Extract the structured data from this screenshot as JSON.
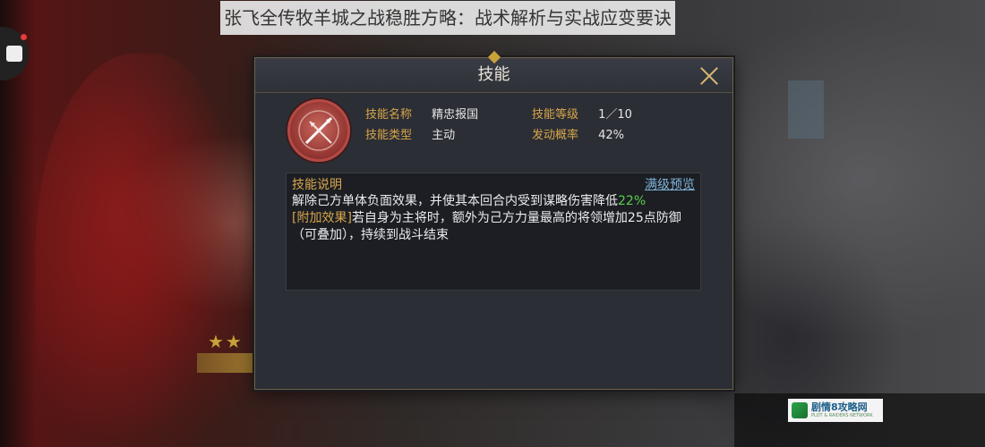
{
  "article_title": "张飞全传牧羊城之战稳胜方略：战术解析与实战应变要诀",
  "dialog": {
    "title": "技能",
    "close_icon": "close-icon"
  },
  "skill": {
    "icon": "crossed-spear-emblem-icon",
    "name_label": "技能名称",
    "name_value": "精忠报国",
    "level_label": "技能等级",
    "level_value": "1／10",
    "type_label": "技能类型",
    "type_value": "主动",
    "chance_label": "发动概率",
    "chance_value": "42%"
  },
  "description": {
    "title": "技能说明",
    "preview_link": "满级预览",
    "line1_text": "解除己方单体负面效果，并使其本回合内受到谋略伤害降低",
    "line1_highlight": "22%",
    "extra_tag": "[附加效果]",
    "extra_text": "若自身为主将时，额外为己方力量最高的将领增加25点防御（可叠加），持续到战斗结束"
  },
  "watermark": {
    "big_text": "剧情8攻略网",
    "small_text": "PLOT & RAIDERS NETWORK"
  },
  "colors": {
    "label_gold": "#d7a64a",
    "highlight_green": "#5bd14a",
    "link_blue": "#7fb3d8",
    "panel_bg": "#2c2e35"
  }
}
